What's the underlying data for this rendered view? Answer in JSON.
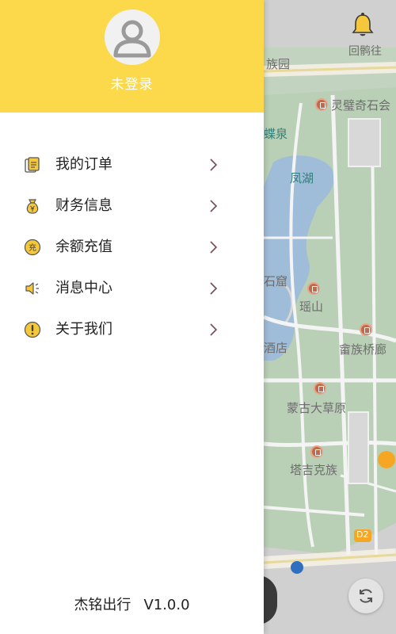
{
  "header": {
    "login_status": "未登录"
  },
  "menu": [
    {
      "label": "我的订单",
      "icon": "order-icon"
    },
    {
      "label": "财务信息",
      "icon": "money-bag-icon"
    },
    {
      "label": "余额充值",
      "icon": "recharge-icon",
      "icon_text": "充"
    },
    {
      "label": "消息中心",
      "icon": "speaker-icon"
    },
    {
      "label": "关于我们",
      "icon": "info-icon"
    }
  ],
  "footer": {
    "app_name": "杰铭出行",
    "version": "V1.0.0"
  },
  "map": {
    "labels": [
      {
        "text": "族园"
      },
      {
        "text": "回鹘往"
      },
      {
        "text": "灵璧奇石会"
      },
      {
        "text": "蝶泉"
      },
      {
        "text": "凤湖"
      },
      {
        "text": "石窟"
      },
      {
        "text": "瑶山"
      },
      {
        "text": "酒店"
      },
      {
        "text": "畲族桥廊"
      },
      {
        "text": "蒙古大草原"
      },
      {
        "text": "塔吉克族"
      },
      {
        "text": "D2"
      }
    ]
  },
  "colors": {
    "accent_yellow": "#fcd94a",
    "menu_icon_yellow": "#f5c73a",
    "arrow_color": "#7a4a55",
    "map_water": "#9dbcd9",
    "map_green": "#bcd3b9"
  }
}
